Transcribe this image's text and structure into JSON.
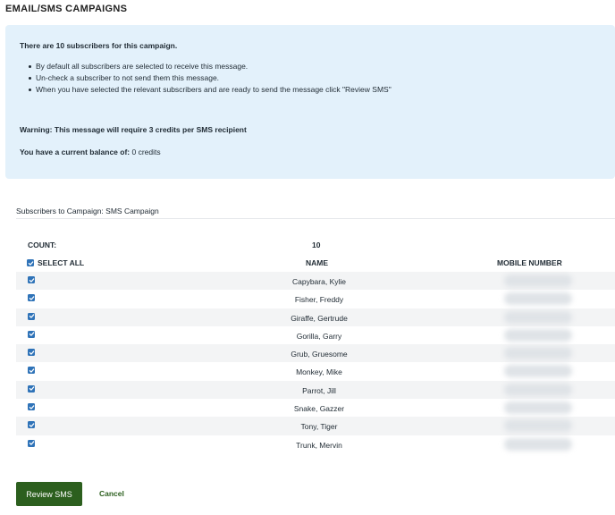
{
  "page": {
    "title": "EMAIL/SMS CAMPAIGNS"
  },
  "info": {
    "headline": "There are 10 subscribers for this campaign.",
    "bullets": [
      "By default all subscribers are selected to receive this message.",
      "Un-check a subscriber to not send them this message.",
      "When you have selected the relevant subscribers and are ready to send the message click \"Review SMS\""
    ],
    "warning": "Warning: This message will require 3 credits per SMS recipient",
    "balance_label": "You have a current balance of:",
    "balance_value": "0 credits"
  },
  "section": {
    "title": "Subscribers to Campaign: SMS Campaign"
  },
  "table": {
    "count_label": "COUNT:",
    "count_value": "10",
    "select_all_label": "SELECT ALL",
    "select_all_checked": true,
    "col_name": "NAME",
    "col_mobile": "MOBILE NUMBER",
    "rows": [
      {
        "name": "Capybara, Kylie",
        "checked": true
      },
      {
        "name": "Fisher, Freddy",
        "checked": true
      },
      {
        "name": "Giraffe, Gertrude",
        "checked": true
      },
      {
        "name": "Gorilla, Garry",
        "checked": true
      },
      {
        "name": "Grub, Gruesome",
        "checked": true
      },
      {
        "name": "Monkey, Mike",
        "checked": true
      },
      {
        "name": "Parrot, Jill",
        "checked": true
      },
      {
        "name": "Snake, Gazzer",
        "checked": true
      },
      {
        "name": "Tony, Tiger",
        "checked": true
      },
      {
        "name": "Trunk, Mervin",
        "checked": true
      }
    ]
  },
  "actions": {
    "review_label": "Review SMS",
    "cancel_label": "Cancel"
  },
  "colors": {
    "info_bg": "#e3f1fb",
    "checkbox": "#2f73b8",
    "primary": "#2c5f1e"
  }
}
